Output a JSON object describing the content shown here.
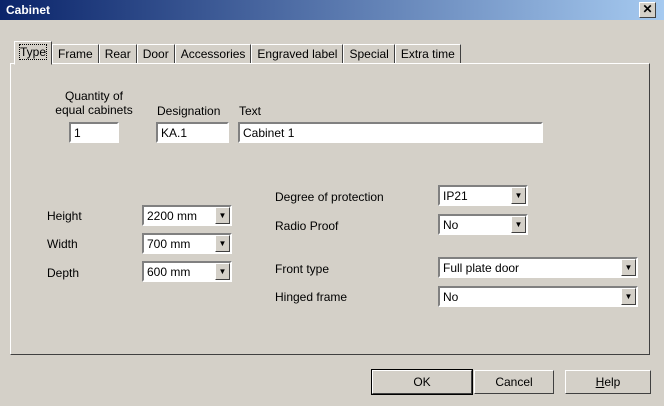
{
  "window": {
    "title": "Cabinet",
    "close_symbol": "✕"
  },
  "tabs": [
    {
      "label": "Type",
      "active": true
    },
    {
      "label": "Frame"
    },
    {
      "label": "Rear"
    },
    {
      "label": "Door"
    },
    {
      "label": "Accessories"
    },
    {
      "label": "Engraved label"
    },
    {
      "label": "Special"
    },
    {
      "label": "Extra time"
    }
  ],
  "general": {
    "quantity_label_line1": "Quantity of",
    "quantity_label_line2": "equal cabinets",
    "quantity_value": "1",
    "designation_label": "Designation",
    "designation_value": "KA.1",
    "text_label": "Text",
    "text_value": "Cabinet 1"
  },
  "dimensions": {
    "height_label": "Height",
    "height_value": "2200 mm",
    "width_label": "Width",
    "width_value": "700 mm",
    "depth_label": "Depth",
    "depth_value": "600 mm"
  },
  "properties": {
    "protection_label": "Degree of protection",
    "protection_value": "IP21",
    "radio_proof_label": "Radio Proof",
    "radio_proof_value": "No",
    "front_type_label": "Front type",
    "front_type_value": "Full plate door",
    "hinged_frame_label": "Hinged frame",
    "hinged_frame_value": "No"
  },
  "buttons": {
    "ok": "OK",
    "cancel": "Cancel",
    "help_prefix": "",
    "help_accel": "H",
    "help_rest": "elp"
  },
  "icons": {
    "dropdown_arrow": "▼",
    "close": "close-icon"
  }
}
